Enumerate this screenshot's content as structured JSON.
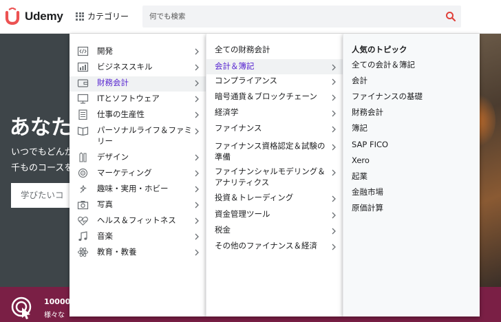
{
  "header": {
    "logo_text": "Udemy",
    "categories_label": "カテゴリー",
    "search_placeholder": "何でも検索"
  },
  "hero": {
    "title": "あなた",
    "subtitle_line1": "いつでもどんか",
    "subtitle_line2": "千ものコースを",
    "search_placeholder": "学びたいコ"
  },
  "banner": {
    "line1": "10000",
    "line2": "様々な"
  },
  "menu": {
    "categories": [
      {
        "label": "開発",
        "icon": "code-icon"
      },
      {
        "label": "ビジネススキル",
        "icon": "chart-icon"
      },
      {
        "label": "財務会計",
        "icon": "wallet-icon",
        "active": true
      },
      {
        "label": "ITとソフトウェア",
        "icon": "monitor-icon"
      },
      {
        "label": "仕事の生産性",
        "icon": "checklist-icon"
      },
      {
        "label": "パーソナルライフ＆ファミリー",
        "icon": "book-icon"
      },
      {
        "label": "デザイン",
        "icon": "pencil-icon"
      },
      {
        "label": "マーケティング",
        "icon": "target-icon"
      },
      {
        "label": "趣味・実用・ホビー",
        "icon": "sparkle-icon"
      },
      {
        "label": "写真",
        "icon": "camera-icon"
      },
      {
        "label": "ヘルス＆フィットネス",
        "icon": "heart-pulse-icon"
      },
      {
        "label": "音楽",
        "icon": "music-note-icon"
      },
      {
        "label": "教育・教養",
        "icon": "atom-icon"
      }
    ],
    "subcategories": [
      {
        "label": "全ての財務会計",
        "has_arrow": false
      },
      {
        "label": "会計＆簿記",
        "has_arrow": true,
        "active": true
      },
      {
        "label": "コンプライアンス",
        "has_arrow": true
      },
      {
        "label": "暗号通貨＆ブロックチェーン",
        "has_arrow": true
      },
      {
        "label": "経済学",
        "has_arrow": true
      },
      {
        "label": "ファイナンス",
        "has_arrow": true
      },
      {
        "label": "ファイナンス資格認定＆試験の準備",
        "has_arrow": true
      },
      {
        "label": "ファイナンシャルモデリング＆アナリティクス",
        "has_arrow": true
      },
      {
        "label": "投資＆トレーディング",
        "has_arrow": true
      },
      {
        "label": "資金管理ツール",
        "has_arrow": true
      },
      {
        "label": "税金",
        "has_arrow": true
      },
      {
        "label": "その他のファイナンス＆経済",
        "has_arrow": true
      }
    ],
    "topics_heading": "人気のトピック",
    "topics": [
      "全ての会計＆簿記",
      "会計",
      "ファイナンスの基礎",
      "財務会計",
      "簿記",
      "SAP FICO",
      "Xero",
      "起業",
      "金融市場",
      "原価計算"
    ]
  },
  "colors": {
    "brand": "#a435f0",
    "logo_red": "#ec5252",
    "active_text": "#5624d0",
    "search_icon": "#e0403a",
    "banner_bg": "#7a1f45"
  }
}
